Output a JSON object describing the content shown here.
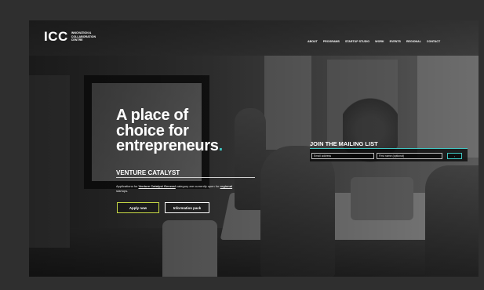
{
  "brand": {
    "logo_mark": "ICC",
    "logo_lines": [
      "INNOVATION &",
      "COLLABORATION",
      "CENTRE"
    ]
  },
  "nav": [
    "ABOUT",
    "PROGRAMS",
    "STARTUP STUDIO",
    "WORK",
    "EVENTS",
    "REGIONAL",
    "CONTACT"
  ],
  "hero": {
    "headline_lines": [
      "A place of",
      "choice for",
      "entrepreneurs"
    ],
    "headline_dot": ".",
    "accent": "#40c6c2"
  },
  "venture": {
    "title": "VENTURE CATALYST",
    "desc_1": "Applications for ",
    "desc_link_1": "Venture Catalyst General",
    "desc_2": " category are currently open for ",
    "desc_link_2": "regional",
    "desc_3": " startups."
  },
  "buttons": {
    "apply": "Apply now",
    "info": "Information pack",
    "apply_border": "#c6d845"
  },
  "mailing": {
    "title": "JOIN THE MAILING LIST",
    "email_placeholder": "Email address",
    "name_placeholder": "First name (optional)",
    "submit": "›"
  }
}
